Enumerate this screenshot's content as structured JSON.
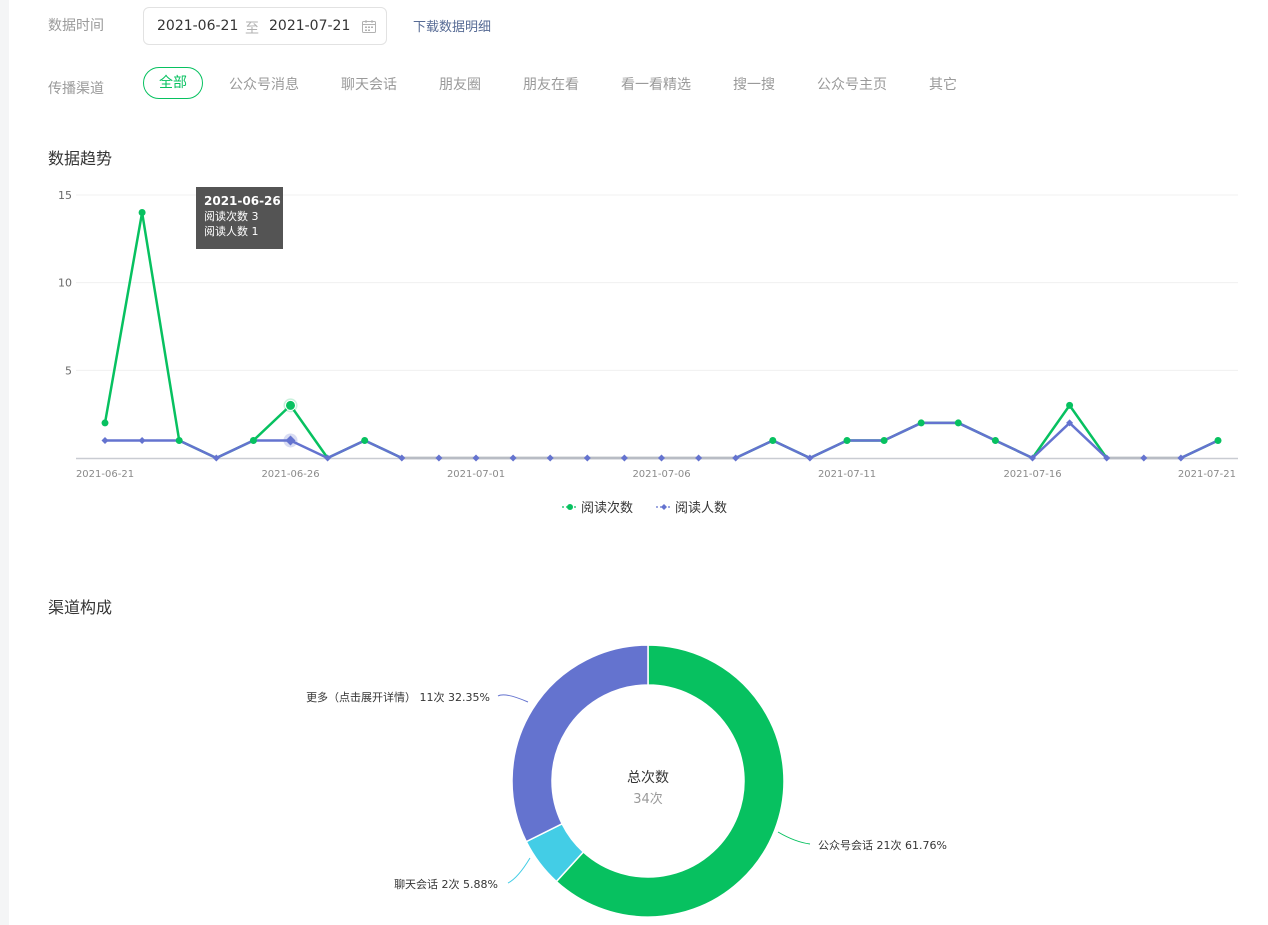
{
  "filters": {
    "date_label": "数据时间",
    "date_start": "2021-06-21",
    "date_sep": "至",
    "date_end": "2021-07-21",
    "download_link": "下载数据明细",
    "channel_label": "传播渠道",
    "channels": [
      "全部",
      "公众号消息",
      "聊天会话",
      "朋友圈",
      "朋友在看",
      "看一看精选",
      "搜一搜",
      "公众号主页",
      "其它"
    ],
    "active_channel": "全部"
  },
  "trend": {
    "title": "数据趋势",
    "tooltip": {
      "date": "2021-06-26",
      "line1": "阅读次数 3",
      "line2": "阅读人数 1"
    },
    "legend": [
      "阅读次数",
      "阅读人数"
    ]
  },
  "composition": {
    "title": "渠道构成",
    "center_title": "总次数",
    "center_value": "34次",
    "labels": {
      "more": "更多（点击展开详情） 11次 32.35%",
      "chat": "聊天会话 2次 5.88%",
      "gzh": "公众号会话 21次 61.76%"
    }
  },
  "colors": {
    "green": "#07c160",
    "blue": "#6473cf",
    "cyan": "#43cde6",
    "grey_line": "#b8bcc4",
    "link": "#576b95"
  },
  "chart_data": [
    {
      "type": "line",
      "title": "数据趋势",
      "x": [
        "2021-06-21",
        "2021-06-22",
        "2021-06-23",
        "2021-06-24",
        "2021-06-25",
        "2021-06-26",
        "2021-06-27",
        "2021-06-28",
        "2021-06-29",
        "2021-06-30",
        "2021-07-01",
        "2021-07-02",
        "2021-07-03",
        "2021-07-04",
        "2021-07-05",
        "2021-07-06",
        "2021-07-07",
        "2021-07-08",
        "2021-07-09",
        "2021-07-10",
        "2021-07-11",
        "2021-07-12",
        "2021-07-13",
        "2021-07-14",
        "2021-07-15",
        "2021-07-16",
        "2021-07-17",
        "2021-07-18",
        "2021-07-19",
        "2021-07-20",
        "2021-07-21"
      ],
      "x_ticks": [
        "2021-06-21",
        "2021-06-26",
        "2021-07-01",
        "2021-07-06",
        "2021-07-11",
        "2021-07-16",
        "2021-07-21"
      ],
      "y_ticks": [
        5,
        10,
        15
      ],
      "ylim": [
        0,
        15
      ],
      "grid": true,
      "legend_position": "bottom",
      "series": [
        {
          "name": "阅读次数",
          "color": "#07c160",
          "values": [
            2,
            14,
            1,
            0,
            1,
            3,
            0,
            1,
            0,
            0,
            0,
            0,
            0,
            0,
            0,
            0,
            0,
            0,
            1,
            0,
            1,
            1,
            2,
            2,
            1,
            0,
            3,
            0,
            0,
            0,
            1
          ]
        },
        {
          "name": "阅读人数",
          "color": "#6473cf",
          "values": [
            1,
            1,
            1,
            0,
            1,
            1,
            0,
            1,
            0,
            0,
            0,
            0,
            0,
            0,
            0,
            0,
            0,
            0,
            1,
            0,
            1,
            1,
            2,
            2,
            1,
            0,
            2,
            0,
            0,
            0,
            1
          ]
        }
      ]
    },
    {
      "type": "pie",
      "title": "渠道构成",
      "donut": true,
      "total": 34,
      "slices": [
        {
          "name": "公众号会话",
          "value": 21,
          "percent": 61.76,
          "color": "#07c160"
        },
        {
          "name": "聊天会话",
          "value": 2,
          "percent": 5.88,
          "color": "#43cde6"
        },
        {
          "name": "更多（点击展开详情）",
          "value": 11,
          "percent": 32.35,
          "color": "#6473cf"
        }
      ]
    }
  ]
}
